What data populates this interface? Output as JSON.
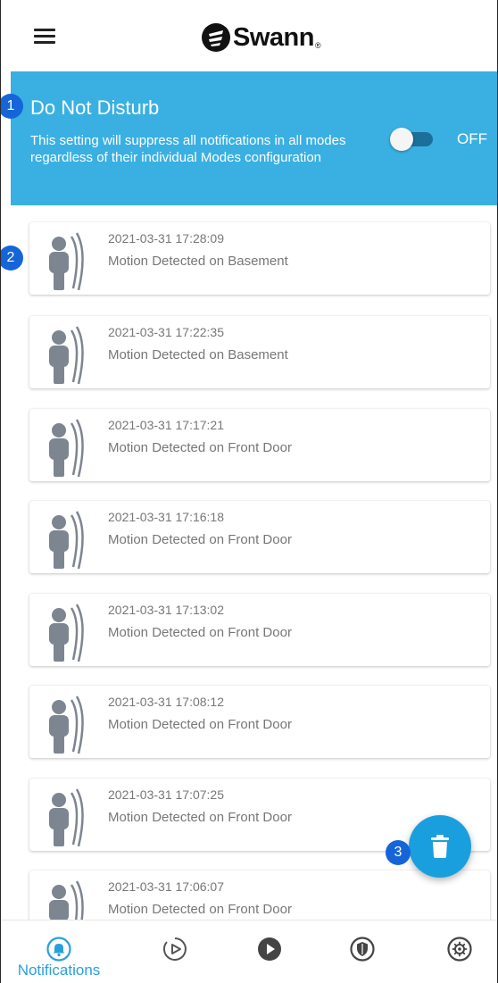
{
  "header": {
    "menu_icon": "hamburger-menu-icon",
    "brand": "Swann",
    "brand_mark": "®"
  },
  "dnd": {
    "title": "Do Not Disturb",
    "description": "This setting will suppress all notifications in all modes regardless of their individual Modes configuration",
    "toggle_state": "OFF",
    "background_color": "#3ab0e2"
  },
  "callouts": [
    "1",
    "2",
    "3"
  ],
  "notifications": [
    {
      "timestamp": "2021-03-31 17:28:09",
      "message": "Motion Detected on Basement",
      "icon": "motion-person-icon"
    },
    {
      "timestamp": "2021-03-31 17:22:35",
      "message": "Motion Detected on Basement",
      "icon": "motion-person-icon"
    },
    {
      "timestamp": "2021-03-31 17:17:21",
      "message": "Motion Detected on Front Door",
      "icon": "motion-person-icon"
    },
    {
      "timestamp": "2021-03-31 17:16:18",
      "message": "Motion Detected on Front Door",
      "icon": "motion-person-icon"
    },
    {
      "timestamp": "2021-03-31 17:13:02",
      "message": "Motion Detected on Front Door",
      "icon": "motion-person-icon"
    },
    {
      "timestamp": "2021-03-31 17:08:12",
      "message": "Motion Detected on Front Door",
      "icon": "motion-person-icon"
    },
    {
      "timestamp": "2021-03-31 17:07:25",
      "message": "Motion Detected on Front Door",
      "icon": "motion-person-icon"
    },
    {
      "timestamp": "2021-03-31 17:06:07",
      "message": "Motion Detected on Front Door",
      "icon": "motion-person-icon"
    }
  ],
  "fab": {
    "icon": "trash-icon",
    "color": "#1a9fde"
  },
  "bottom_nav": {
    "active_label": "Notifications",
    "active_color": "#2a9fe0",
    "items": [
      "bell-icon",
      "playback-icon",
      "live-play-icon",
      "shield-icon",
      "settings-gear-icon"
    ]
  }
}
